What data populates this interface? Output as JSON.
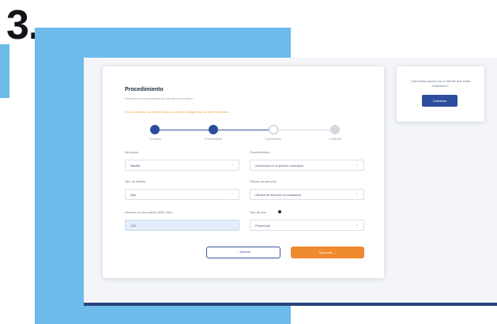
{
  "header": {
    "step_number": "3."
  },
  "form": {
    "title": "Procedimiento",
    "subtitle": "Selecciona el procedimiento que deseas realizar",
    "note": "Para continuar, completa todos los campos obligatorios de este formulario",
    "steps": [
      {
        "label": "Tus datos",
        "state": "done"
      },
      {
        "label": "Procedimiento",
        "state": "done"
      },
      {
        "label": "Documentos",
        "state": "current"
      },
      {
        "label": "Confirmar",
        "state": "todo"
      }
    ],
    "fields": {
      "f1": {
        "label": "Municipio",
        "value": "Madrid"
      },
      "f2": {
        "label": "Procedimiento",
        "value": "Inscripción en el padrón municipal"
      },
      "f3": {
        "label": "Tipo de trámite",
        "value": "Alta"
      },
      "f4": {
        "label": "Oficina de atención",
        "value": "Oficina de atención al ciudadano"
      },
      "f5": {
        "label": "Número de documento (DNI, NIE)",
        "value": "123"
      },
      "f6": {
        "label": "Tipo de cita",
        "value": "Presencial"
      }
    },
    "buttons": {
      "back": "Anterior",
      "next": "Siguiente"
    }
  },
  "help": {
    "text": "¿Necesitas ayuda con el trámite que estás realizando?",
    "button": "Contactar"
  }
}
